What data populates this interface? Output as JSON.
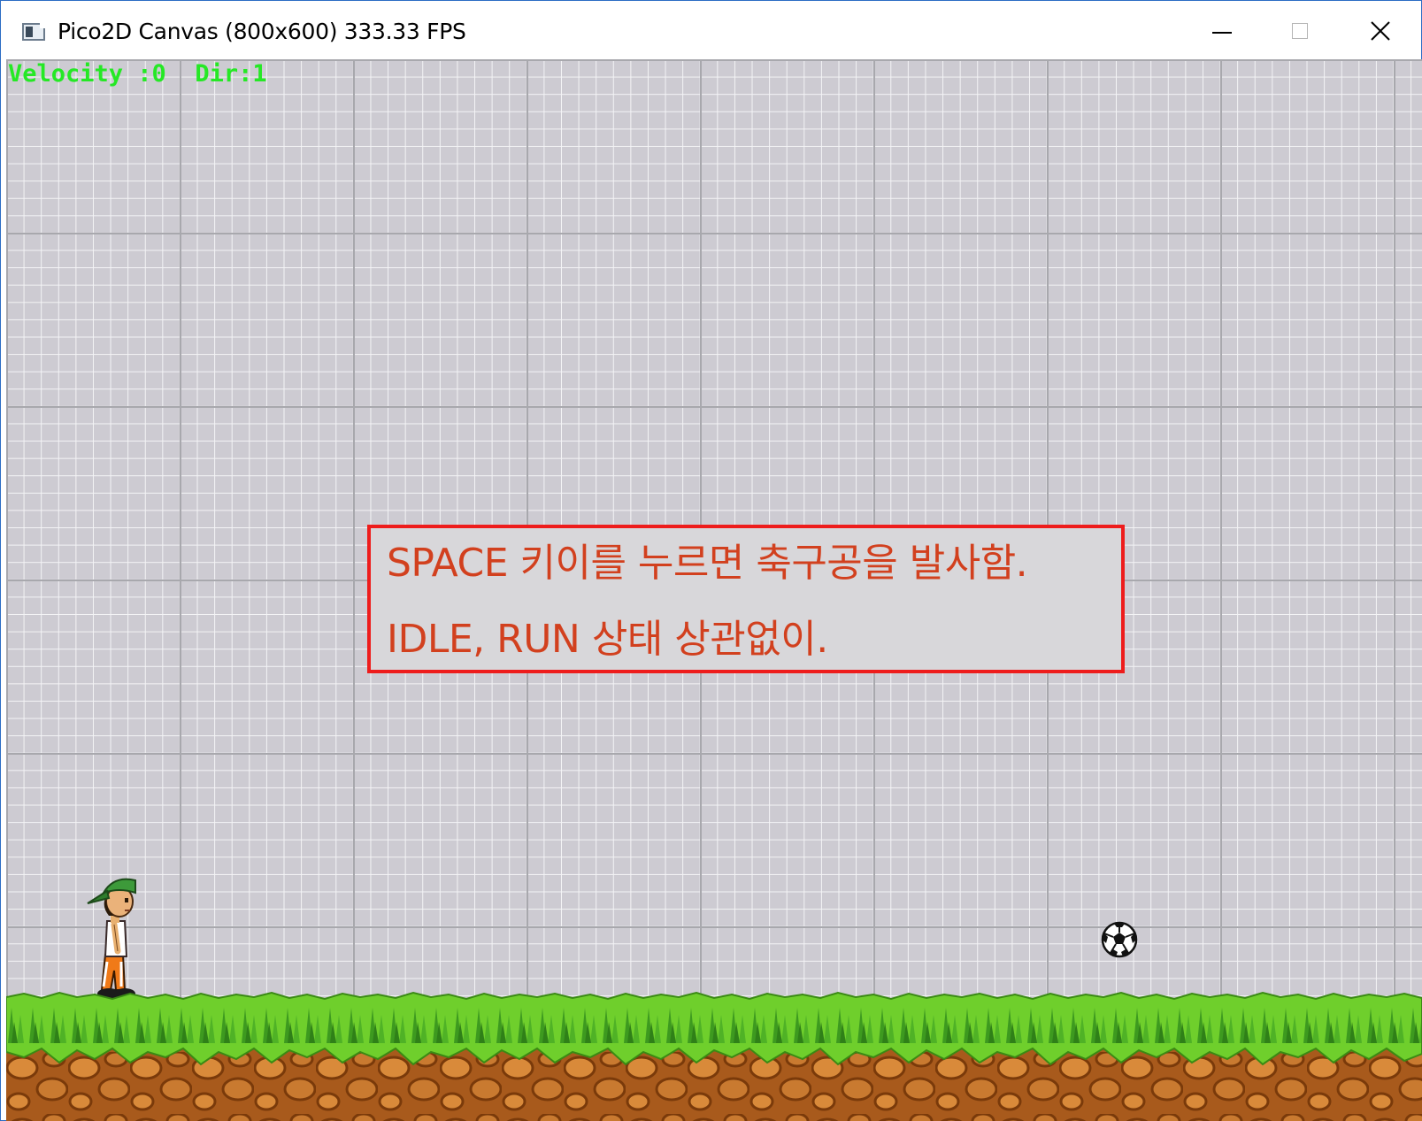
{
  "window": {
    "title": "Pico2D Canvas (800x600) 333.33 FPS",
    "icon": "app-window-icon",
    "controls": [
      "minimize-icon",
      "maximize-icon",
      "close-icon"
    ]
  },
  "hud": {
    "text": "Velocity :0  Dir:1",
    "color": "#25e825"
  },
  "notice": {
    "line1": "SPACE 키이를 누르면 축구공을 발사함.",
    "line2": "IDLE, RUN 상태 상관없이.",
    "border_color": "#ee1c1c",
    "text_color": "#d2401e"
  },
  "scene": {
    "background": "grid",
    "ground": "grass-dirt",
    "player": "boy-with-green-cap",
    "ball": "soccer-ball"
  }
}
